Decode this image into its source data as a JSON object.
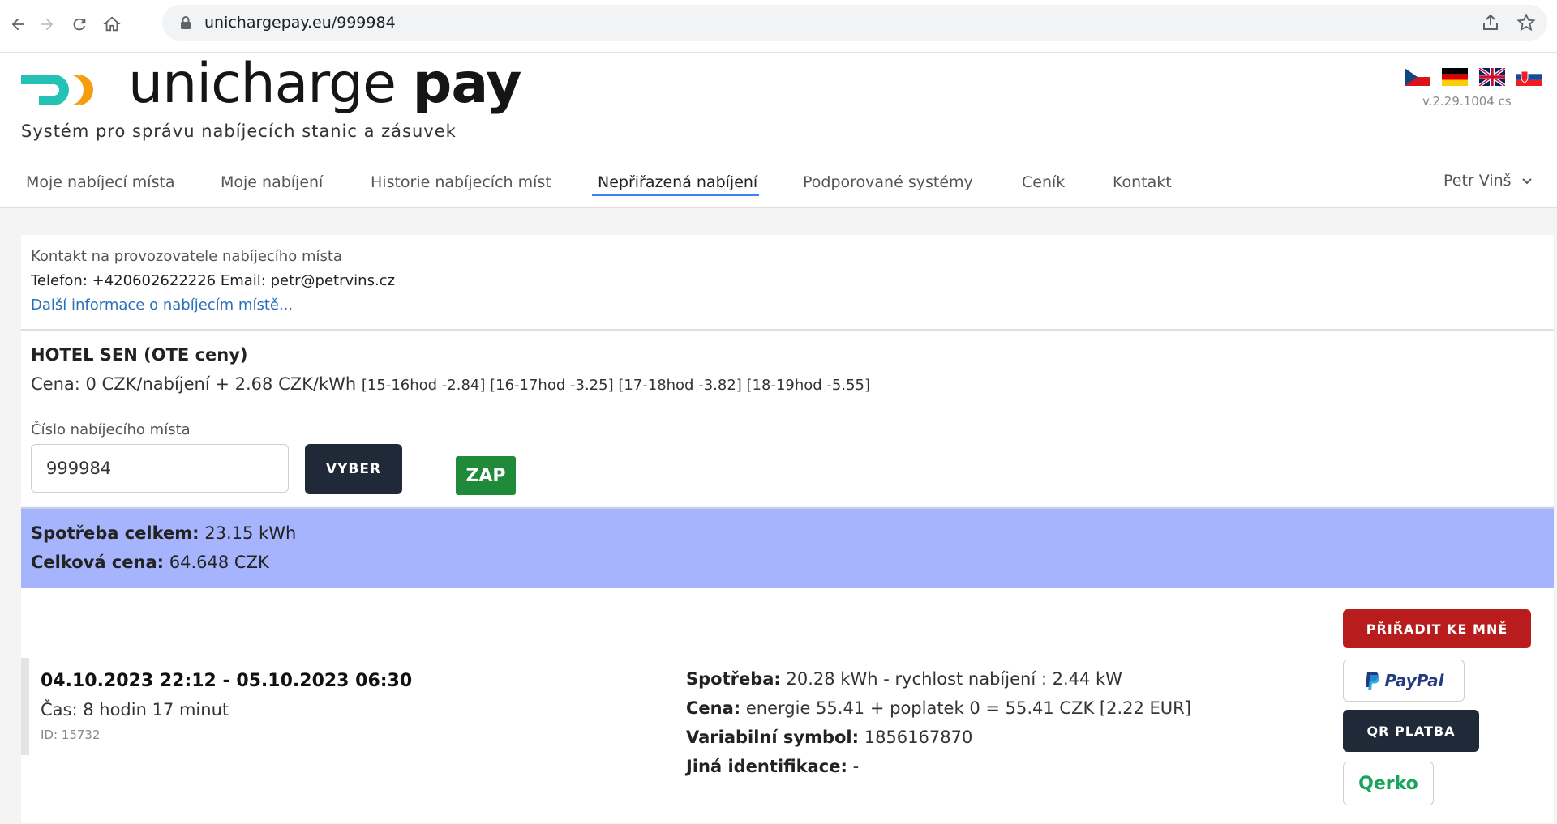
{
  "browser": {
    "url": "unichargepay.eu/999984"
  },
  "header": {
    "brand_light": "unicharge",
    "brand_bold": "pay",
    "tagline": "Systém pro správu nabíjecích stanic a zásuvek",
    "version": "v.2.29.1004 cs"
  },
  "menu": {
    "items": [
      {
        "label": "Moje nabíjecí místa"
      },
      {
        "label": "Moje nabíjení"
      },
      {
        "label": "Historie nabíjecích míst"
      },
      {
        "label": "Nepřiřazená nabíjení"
      },
      {
        "label": "Podporované systémy"
      },
      {
        "label": "Ceník"
      },
      {
        "label": "Kontakt"
      }
    ],
    "active": "Nepřiřazená nabíjení",
    "user": "Petr Vinš"
  },
  "contact": {
    "title": "Kontakt na provozovatele nabíjecího místa",
    "details": "Telefon: +420602622226  Email: petr@petrvins.cz",
    "more_link": "Další informace o nabíjecím místě..."
  },
  "station": {
    "name": "HOTEL SEN (OTE ceny)",
    "price": "Cena: 0 CZK/nabíjení + 2.68 CZK/kWh",
    "slots": "[15-16hod -2.84] [16-17hod -3.25] [17-18hod -3.82] [18-19hod -5.55]",
    "field_label": "Číslo nabíjecího místa",
    "field_value": "999984",
    "select_label": "VYBER",
    "on_label": "ZAP"
  },
  "summary": {
    "consumption_label": "Spotřeba celkem:",
    "consumption_value": "23.15 kWh",
    "total_label": "Celková cena:",
    "total_value": "64.648 CZK"
  },
  "session": {
    "range": "04.10.2023 22:12 - 05.10.2023 06:30",
    "duration": "Čas: 8 hodin 17 minut",
    "id": "ID: 15732",
    "consumption_label": "Spotřeba:",
    "consumption_value": "20.28 kWh - rychlost nabíjení : 2.44 kW",
    "price_label": "Cena:",
    "price_value": "energie 55.41 + poplatek 0 = 55.41 CZK [2.22 EUR]",
    "vs_label": "Variabilní symbol:",
    "vs_value": "1856167870",
    "other_label": "Jiná identifikace:",
    "other_value": "-",
    "assign_label": "PŘIŘADIT KE MNĚ",
    "paypal_label": "PayPal",
    "qr_label": "QR PLATBA",
    "qerko_label": "Qerko"
  },
  "colors": {
    "summary_bg": "#a5b4fc",
    "assign_btn": "#b91c1c",
    "dark_btn": "#1f2937",
    "zap_btn": "#1e8a3a",
    "logo_teal": "#23c2b4",
    "logo_orange": "#f59e0b",
    "paypal_dark": "#253b80",
    "paypal_light": "#179bd7",
    "qerko_green": "#1aa35c"
  }
}
